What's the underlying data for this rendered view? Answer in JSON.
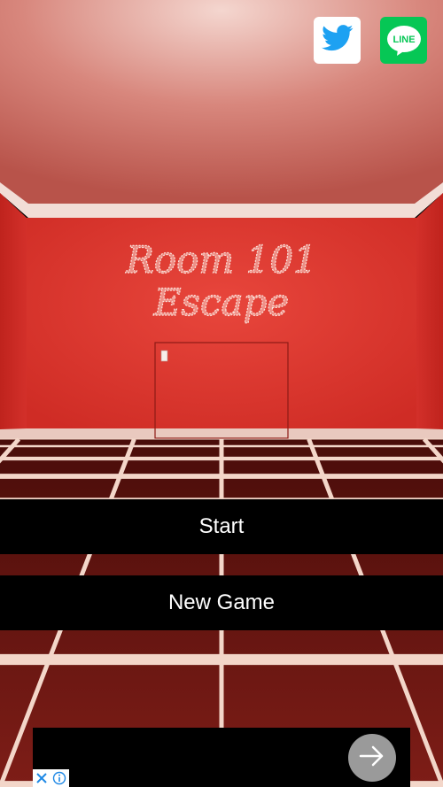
{
  "game": {
    "title_line1": "Room 101",
    "title_line2": "Escape"
  },
  "share": {
    "twitter_icon": "twitter-bird-icon",
    "line_label": "LINE"
  },
  "menu": {
    "start_label": "Start",
    "new_game_label": "New Game"
  },
  "ad": {
    "arrow_icon": "arrow-right-icon",
    "close_icon": "close-icon",
    "info_icon": "info-icon"
  },
  "colors": {
    "wall": "#e0342c",
    "ceiling": "#c86a60",
    "floor_tile": "#7a1a14",
    "grout": "#f3d6c9",
    "line_green": "#06c755",
    "twitter_blue": "#1da1f2"
  }
}
